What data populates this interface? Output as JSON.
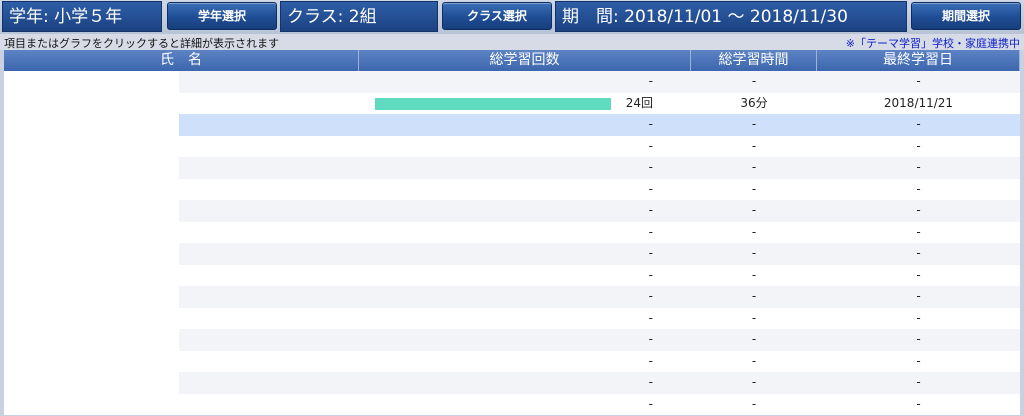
{
  "topbar": {
    "grade_label": "学年: 小学５年",
    "grade_button": "学年選択",
    "class_label": "クラス: 2組",
    "class_button": "クラス選択",
    "period_label": "期　間: 2018/11/01 ～ 2018/11/30",
    "period_button": "期間選択"
  },
  "hints": {
    "left": "項目またはグラフをクリックすると詳細が表示されます",
    "right": "※「テーマ学習」学校・家庭連携中"
  },
  "table": {
    "headers": {
      "name": "氏　名",
      "count": "総学習回数",
      "time": "総学習時間",
      "last": "最終学習日"
    },
    "max_count": 24,
    "rows": [
      {
        "count": "-",
        "time": "-",
        "last": "-",
        "bar": 0
      },
      {
        "count": "24回",
        "time": "36分",
        "last": "2018/11/21",
        "bar": 24
      },
      {
        "count": "-",
        "time": "-",
        "last": "-",
        "bar": 0
      },
      {
        "count": "-",
        "time": "-",
        "last": "-",
        "bar": 0
      },
      {
        "count": "-",
        "time": "-",
        "last": "-",
        "bar": 0
      },
      {
        "count": "-",
        "time": "-",
        "last": "-",
        "bar": 0
      },
      {
        "count": "-",
        "time": "-",
        "last": "-",
        "bar": 0
      },
      {
        "count": "-",
        "time": "-",
        "last": "-",
        "bar": 0
      },
      {
        "count": "-",
        "time": "-",
        "last": "-",
        "bar": 0
      },
      {
        "count": "-",
        "time": "-",
        "last": "-",
        "bar": 0
      },
      {
        "count": "-",
        "time": "-",
        "last": "-",
        "bar": 0
      },
      {
        "count": "-",
        "time": "-",
        "last": "-",
        "bar": 0
      },
      {
        "count": "-",
        "time": "-",
        "last": "-",
        "bar": 0
      },
      {
        "count": "-",
        "time": "-",
        "last": "-",
        "bar": 0
      },
      {
        "count": "-",
        "time": "-",
        "last": "-",
        "bar": 0
      },
      {
        "count": "-",
        "time": "-",
        "last": "-",
        "bar": 0
      }
    ]
  },
  "colors": {
    "header_blue": "#3c66ad",
    "bar_color": "#5fdcc0",
    "selected_row": "#cfe0fb",
    "hint_link": "#1022c8"
  }
}
